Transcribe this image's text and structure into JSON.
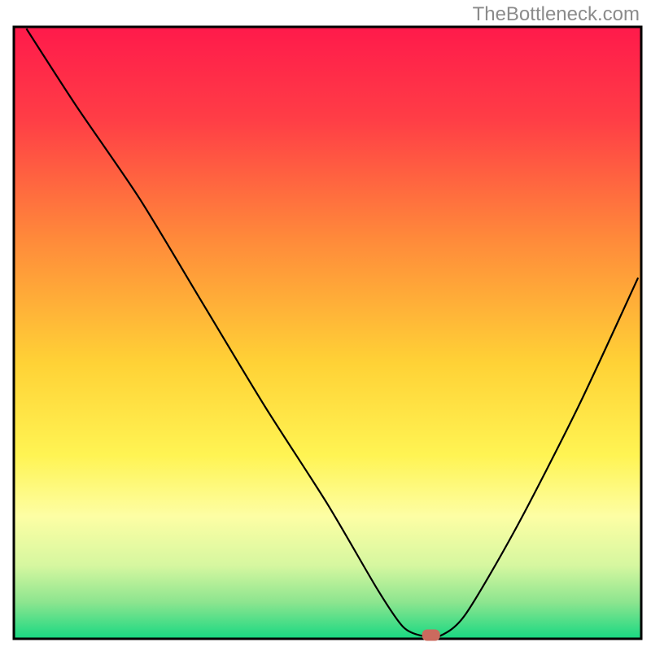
{
  "watermark": "TheBottleneck.com",
  "chart_data": {
    "type": "line",
    "title": "",
    "xlabel": "",
    "ylabel": "",
    "xlim": [
      0,
      100
    ],
    "ylim": [
      0,
      100
    ],
    "grid": false,
    "legend": false,
    "note": "Axes have no visible tick labels in the image; values below are normalized 0–100 within the plot frame. y=0 is the bottom edge, y=100 is the top edge.",
    "series": [
      {
        "name": "bottleneck-curve",
        "x": [
          2,
          10,
          20,
          30,
          40,
          50,
          58,
          62,
          65,
          68,
          72,
          80,
          90,
          99.5
        ],
        "y": [
          99.7,
          87,
          72,
          55,
          38,
          22,
          8,
          2,
          0.5,
          0.5,
          4,
          18,
          38,
          59
        ]
      }
    ],
    "marker": {
      "name": "optimal-point",
      "x": 66.5,
      "y": 0.6,
      "color": "#cb6a5e",
      "shape": "rounded-rect"
    },
    "background_gradient": {
      "description": "vertical gradient inside plot area, red at top through orange/yellow to green at bottom",
      "stops": [
        {
          "pos": 0.0,
          "color": "#ff1a4b"
        },
        {
          "pos": 0.15,
          "color": "#ff3d46"
        },
        {
          "pos": 0.35,
          "color": "#ff8b3a"
        },
        {
          "pos": 0.55,
          "color": "#ffd236"
        },
        {
          "pos": 0.7,
          "color": "#fff453"
        },
        {
          "pos": 0.8,
          "color": "#fdfea4"
        },
        {
          "pos": 0.88,
          "color": "#d6f7a0"
        },
        {
          "pos": 0.94,
          "color": "#8de58f"
        },
        {
          "pos": 1.0,
          "color": "#17d882"
        }
      ]
    },
    "frame": {
      "stroke": "#000000",
      "stroke_width": 3
    }
  }
}
